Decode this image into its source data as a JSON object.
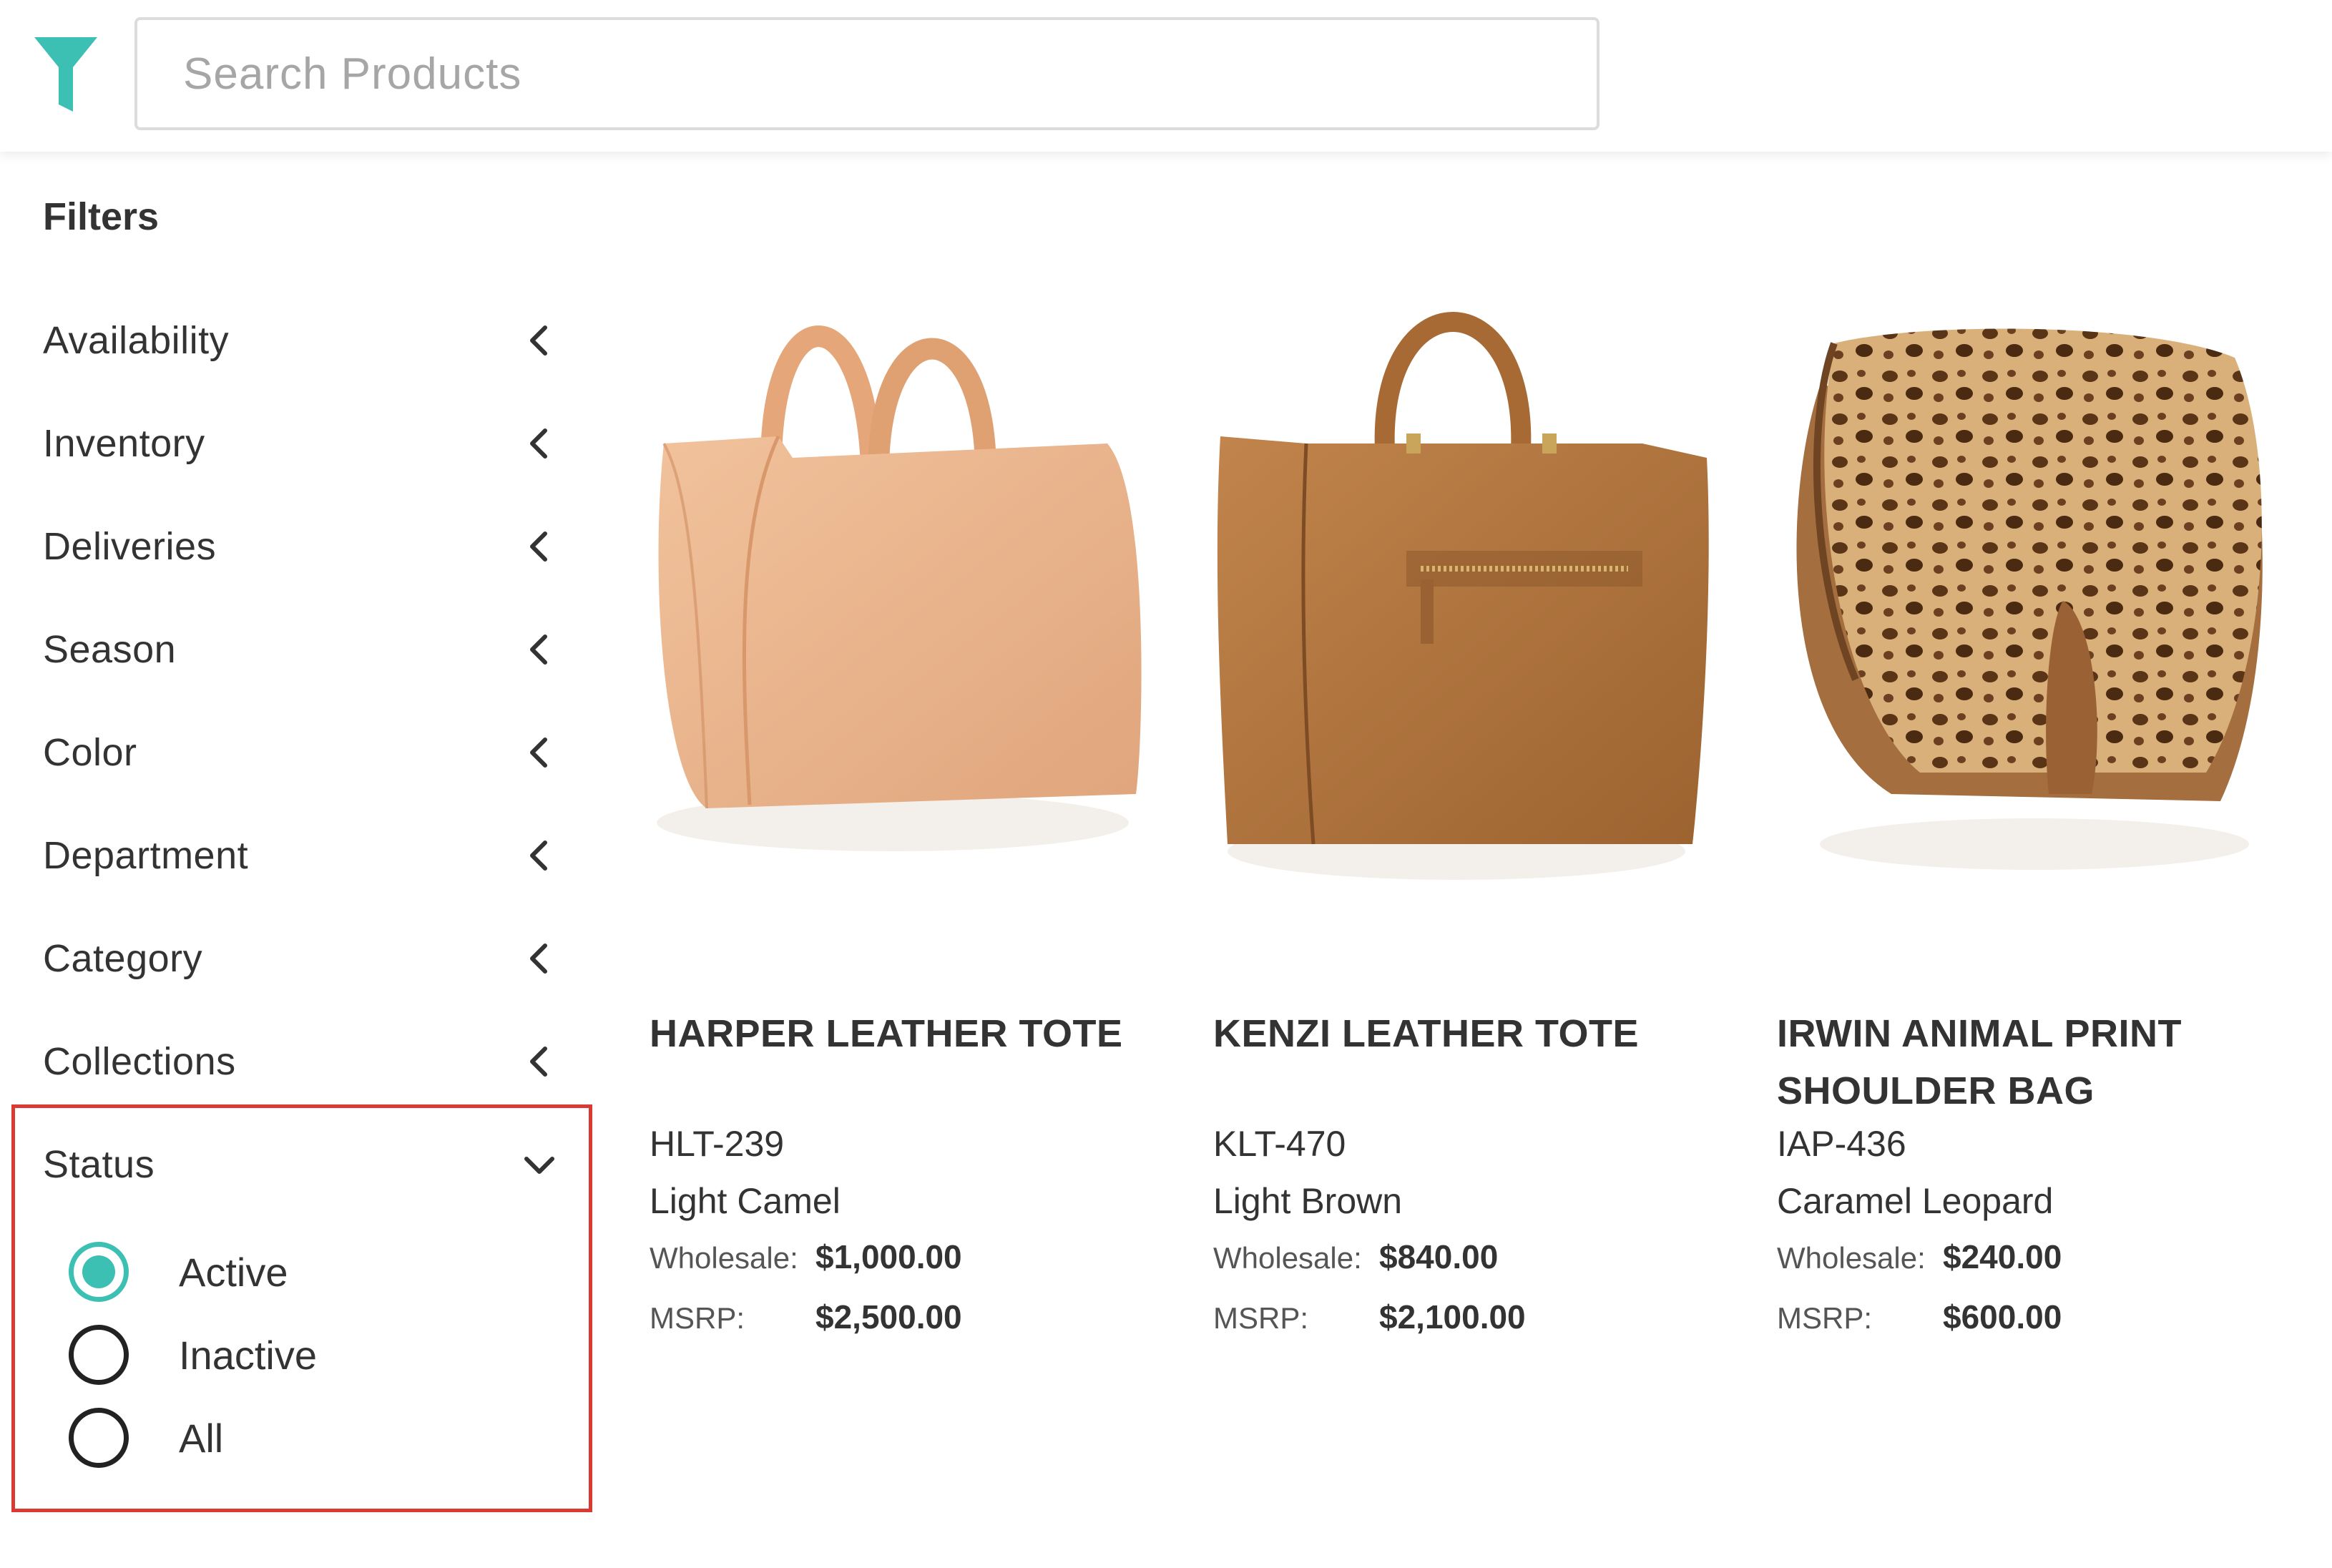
{
  "header": {
    "search_placeholder": "Search Products",
    "logo_icon": "funnel-icon",
    "accent_color": "#3cc0b3"
  },
  "sidebar": {
    "title": "Filters",
    "items": [
      {
        "label": "Availability",
        "icon": "chevron-left-icon"
      },
      {
        "label": "Inventory",
        "icon": "chevron-left-icon"
      },
      {
        "label": "Deliveries",
        "icon": "chevron-left-icon"
      },
      {
        "label": "Season",
        "icon": "chevron-left-icon"
      },
      {
        "label": "Color",
        "icon": "chevron-left-icon"
      },
      {
        "label": "Department",
        "icon": "chevron-left-icon"
      },
      {
        "label": "Category",
        "icon": "chevron-left-icon"
      },
      {
        "label": "Collections",
        "icon": "chevron-left-icon"
      }
    ],
    "status": {
      "label": "Status",
      "icon": "chevron-down-icon",
      "highlight_color": "#d93a32",
      "options": [
        {
          "label": "Active",
          "checked": true
        },
        {
          "label": "Inactive",
          "checked": false
        },
        {
          "label": "All",
          "checked": false
        }
      ]
    }
  },
  "products": [
    {
      "name": "HARPER LEATHER TOTE",
      "sku": "HLT-239",
      "color": "Light Camel",
      "wholesale_label": "Wholesale:",
      "wholesale": "$1,000.00",
      "msrp_label": "MSRP:",
      "msrp": "$2,500.00"
    },
    {
      "name": "KENZI LEATHER TOTE",
      "sku": "KLT-470",
      "color": "Light Brown",
      "wholesale_label": "Wholesale:",
      "wholesale": "$840.00",
      "msrp_label": "MSRP:",
      "msrp": "$2,100.00"
    },
    {
      "name": "IRWIN ANIMAL PRINT SHOULDER BAG",
      "sku": "IAP-436",
      "color": "Caramel Leopard",
      "wholesale_label": "Wholesale:",
      "wholesale": "$240.00",
      "msrp_label": "MSRP:",
      "msrp": "$600.00"
    }
  ]
}
